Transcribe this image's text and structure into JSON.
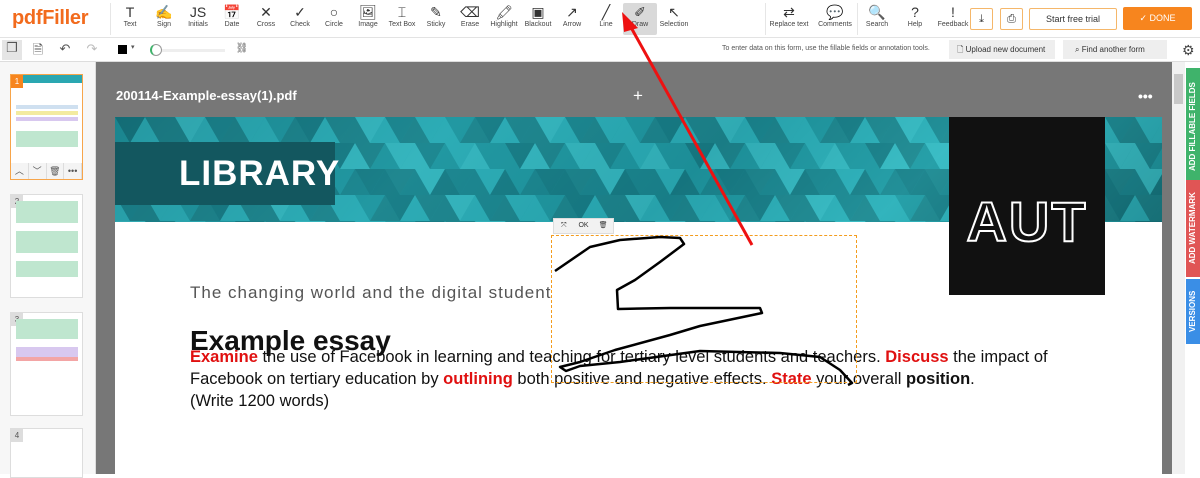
{
  "app": {
    "logo": "pdfFiller"
  },
  "tools": [
    {
      "label": "Text",
      "icon": "T"
    },
    {
      "label": "Sign",
      "icon": "✍"
    },
    {
      "label": "Initials",
      "icon": "JS"
    },
    {
      "label": "Date",
      "icon": "📅"
    },
    {
      "label": "Cross",
      "icon": "✕"
    },
    {
      "label": "Check",
      "icon": "✓"
    },
    {
      "label": "Circle",
      "icon": "○"
    },
    {
      "label": "Image",
      "icon": "🖼"
    },
    {
      "label": "Text Box",
      "icon": "⌶"
    },
    {
      "label": "Sticky",
      "icon": "✎"
    },
    {
      "label": "Erase",
      "icon": "⌫"
    },
    {
      "label": "Highlight",
      "icon": "🖍"
    },
    {
      "label": "Blackout",
      "icon": "▣"
    },
    {
      "label": "Arrow",
      "icon": "↗"
    },
    {
      "label": "Line",
      "icon": "╱"
    },
    {
      "label": "Draw",
      "icon": "✐"
    },
    {
      "label": "Selection",
      "icon": "↖"
    }
  ],
  "active_tool": "Draw",
  "right_tools": [
    {
      "label": "Replace text",
      "icon": "⇄"
    },
    {
      "label": "Comments",
      "icon": "💬"
    }
  ],
  "help_tools": [
    {
      "label": "Search",
      "icon": "🔍"
    },
    {
      "label": "Help",
      "icon": "?"
    },
    {
      "label": "Feedback",
      "icon": "!"
    }
  ],
  "buttons": {
    "download": "⤓",
    "print": "⎙",
    "trial": "Start free trial",
    "done": "✓ DONE"
  },
  "bar2": {
    "hint": "To enter data on this form, use the fillable fields or annotation tools.",
    "upload": "Upload new document",
    "find": "Find another form"
  },
  "thumbnails": [
    {
      "num": "1"
    },
    {
      "num": "2"
    },
    {
      "num": "3"
    },
    {
      "num": "4"
    }
  ],
  "document": {
    "filename": "200114-Example-essay(1).pdf",
    "banner": "LIBRARY",
    "logo": "AUT",
    "subtitle": "The changing world and the digital student",
    "heading": "Example essay",
    "p": [
      "Examine",
      " the use of Facebook in learning and teaching for tertiary level students and teachers. ",
      "Discuss",
      " the impact of Facebook on tertiary education by ",
      "outlining",
      " both positive and negative effects. ",
      "State",
      " your overall ",
      "position",
      ".",
      "(Write 1200 words)"
    ]
  },
  "draw_toolbar": {
    "ok": "OK"
  },
  "side_tabs": [
    "ADD FILLABLE FIELDS",
    "ADD WATERMARK",
    "VERSIONS"
  ],
  "colors": {
    "accent": "#f7851e",
    "teal": "#13575f",
    "green": "#3fb36b",
    "red": "#e05555",
    "blue": "#3a8ee6"
  }
}
